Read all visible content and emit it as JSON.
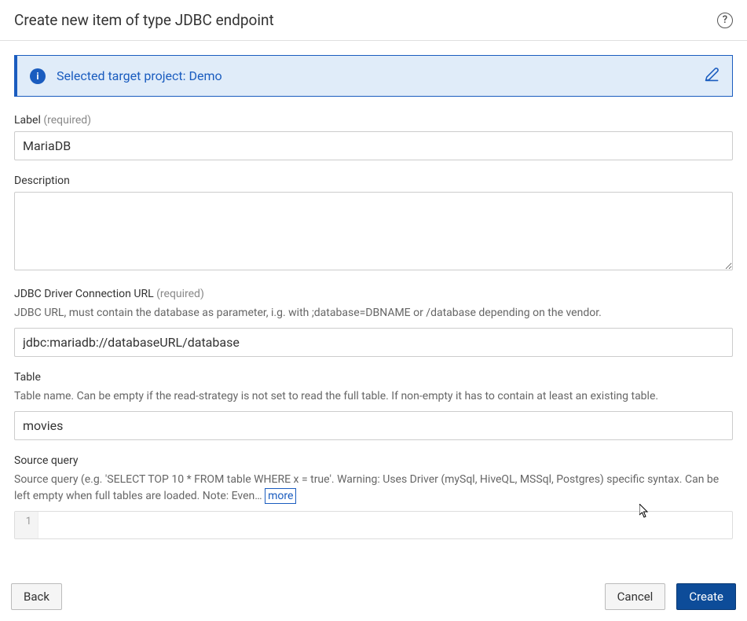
{
  "header": {
    "title": "Create new item of type JDBC endpoint"
  },
  "banner": {
    "text": "Selected target project: Demo"
  },
  "fields": {
    "label": {
      "label": "Label",
      "required_hint": "(required)",
      "value": "MariaDB"
    },
    "description": {
      "label": "Description",
      "value": ""
    },
    "jdbc_url": {
      "label": "JDBC Driver Connection URL",
      "required_hint": "(required)",
      "help": "JDBC URL, must contain the database as parameter, i.g. with ;database=DBNAME or /database depending on the vendor.",
      "value": "jdbc:mariadb://databaseURL/database"
    },
    "table": {
      "label": "Table",
      "help": "Table name. Can be empty if the read-strategy is not set to read the full table. If non-empty it has to contain at least an existing table.",
      "value": "movies"
    },
    "source_query": {
      "label": "Source query",
      "help": "Source query (e.g. 'SELECT TOP 10 * FROM table WHERE x = true'. Warning: Uses Driver (mySql, HiveQL, MSSql, Postgres) specific syntax. Can be left empty when full tables are loaded. Note: Even…",
      "more_label": "more",
      "line_number": "1"
    }
  },
  "footer": {
    "back": "Back",
    "cancel": "Cancel",
    "create": "Create"
  }
}
